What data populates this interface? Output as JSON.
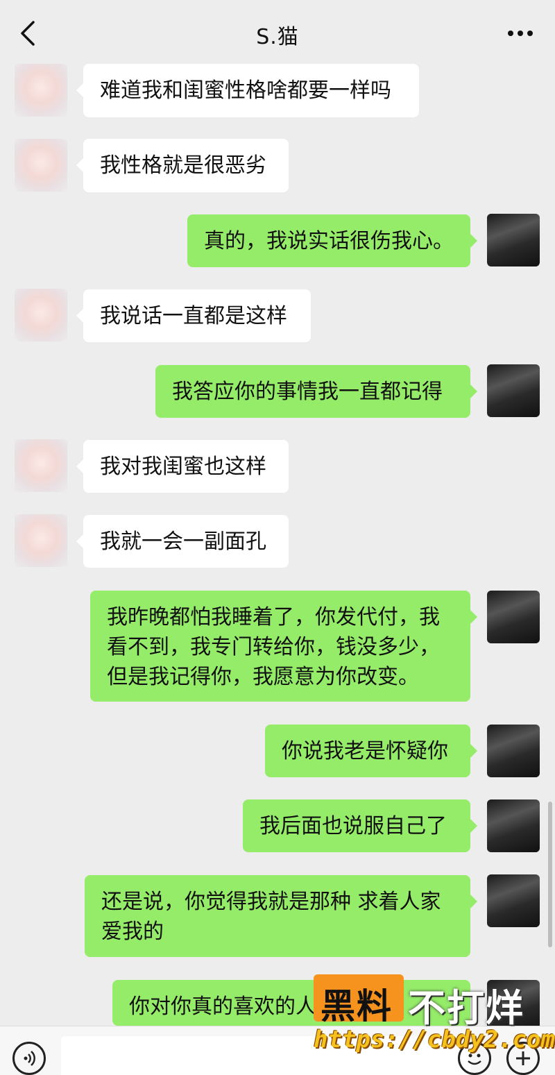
{
  "header": {
    "title": "S.猫",
    "back_icon": "chevron-left-icon",
    "more_icon": "more-dots-icon"
  },
  "messages": [
    {
      "side": "left",
      "text": "难道我和闺蜜性格啥都要一样吗"
    },
    {
      "side": "left",
      "text": "我性格就是很恶劣"
    },
    {
      "side": "right",
      "text": "真的，我说实话很伤我心。"
    },
    {
      "side": "left",
      "text": "我说话一直都是这样"
    },
    {
      "side": "right",
      "text": "我答应你的事情我一直都记得"
    },
    {
      "side": "left",
      "text": "我对我闺蜜也这样"
    },
    {
      "side": "left",
      "text": "我就一会一副面孔"
    },
    {
      "side": "right",
      "text": "我昨晚都怕我睡着了，你发代付，我看不到，我专门转给你，钱没多少，但是我记得你，我愿意为你改变。"
    },
    {
      "side": "right",
      "text": "你说我老是怀疑你"
    },
    {
      "side": "right",
      "text": "我后面也说服自己了"
    },
    {
      "side": "right",
      "text": "还是说，你觉得我就是那种 求着人家爱我的"
    },
    {
      "side": "right",
      "text": "你对你真的喜欢的人"
    }
  ],
  "watermark": {
    "part1": "黑料",
    "part2": "不打烊",
    "url": "https://cbdy2.com"
  },
  "colors": {
    "background": "#ededed",
    "bubble_self": "#95ec69",
    "bubble_other": "#ffffff"
  }
}
